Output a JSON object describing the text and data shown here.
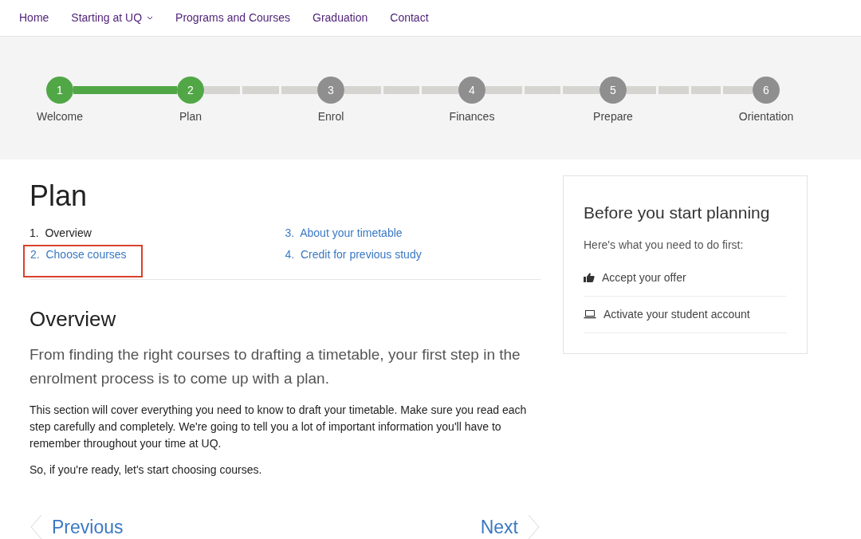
{
  "nav": [
    {
      "label": "Home",
      "dropdown": false
    },
    {
      "label": "Starting at UQ",
      "dropdown": true
    },
    {
      "label": "Programs and Courses",
      "dropdown": false
    },
    {
      "label": "Graduation",
      "dropdown": false
    },
    {
      "label": "Contact",
      "dropdown": false
    }
  ],
  "steps": [
    {
      "number": "1",
      "label": "Welcome",
      "completed": true
    },
    {
      "number": "2",
      "label": "Plan",
      "completed": true
    },
    {
      "number": "3",
      "label": "Enrol",
      "completed": false
    },
    {
      "number": "4",
      "label": "Finances",
      "completed": false
    },
    {
      "number": "5",
      "label": "Prepare",
      "completed": false
    },
    {
      "number": "6",
      "label": "Orientation",
      "completed": false
    }
  ],
  "page_title": "Plan",
  "contents": [
    {
      "number": "1.",
      "label": "Overview",
      "selected": true,
      "highlighted": false
    },
    {
      "number": "2.",
      "label": "Choose courses",
      "selected": false,
      "highlighted": true
    },
    {
      "number": "3.",
      "label": "About your timetable",
      "selected": false,
      "highlighted": false
    },
    {
      "number": "4.",
      "label": "Credit for previous study",
      "selected": false,
      "highlighted": false
    }
  ],
  "section_title": "Overview",
  "lead": "From finding the right courses to drafting a timetable, your first step in the enrolment process is to come up with a plan.",
  "paragraphs": [
    "This section will cover everything you need to know to draft your timetable. Make sure you read each step carefully and completely. We're going to tell you a lot of important information you'll have to remember throughout your time at UQ.",
    "So, if you're ready, let's start choosing courses."
  ],
  "pager": {
    "previous": "Previous",
    "next": "Next"
  },
  "sidebar": {
    "title": "Before you start planning",
    "intro": "Here's what you need to do first:",
    "items": [
      {
        "kind": "thumbs-up",
        "label": "Accept your offer"
      },
      {
        "kind": "laptop",
        "label": "Activate your student account"
      }
    ]
  }
}
